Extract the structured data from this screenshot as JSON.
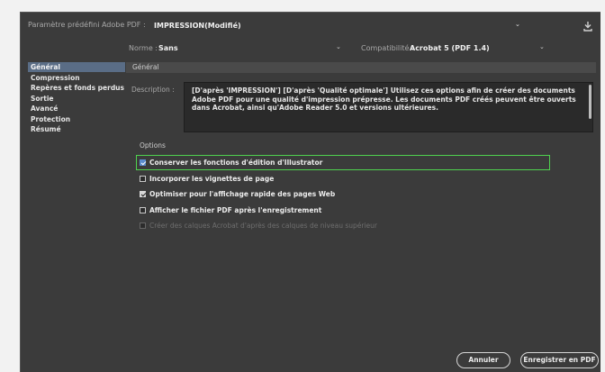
{
  "preset": {
    "label": "Paramètre prédéfini Adobe PDF :",
    "value": "IMPRESSION(Modifié)"
  },
  "standard": {
    "label": "Norme :",
    "value": "Sans"
  },
  "compatibility": {
    "label": "Compatibilité :",
    "value": "Acrobat 5 (PDF 1.4)"
  },
  "sidebar": {
    "items": [
      {
        "label": "Général",
        "active": true
      },
      {
        "label": "Compression",
        "active": false
      },
      {
        "label": "Repères et fonds perdus",
        "active": false
      },
      {
        "label": "Sortie",
        "active": false
      },
      {
        "label": "Avancé",
        "active": false
      },
      {
        "label": "Protection",
        "active": false
      },
      {
        "label": "Résumé",
        "active": false
      }
    ]
  },
  "general": {
    "header": "Général",
    "description_label": "Description :",
    "description_lines": [
      "[D'après 'IMPRESSION'] [D'après 'Qualité optimale'] Utilisez ces options afin de créer des documents",
      "Adobe PDF pour une qualité d'impression prépresse. Les documents PDF créés peuvent être ouverts",
      "dans Acrobat, ainsi qu'Adobe Reader 5.0 et versions ultérieures."
    ],
    "options_title": "Options",
    "options": [
      {
        "label": "Conserver les fonctions d'édition d'Illustrator",
        "checked": true,
        "enabled": true
      },
      {
        "label": "Incorporer les vignettes de page",
        "checked": false,
        "enabled": true
      },
      {
        "label": "Optimiser pour l'affichage rapide des pages Web",
        "checked": true,
        "enabled": true
      },
      {
        "label": "Afficher le fichier PDF après l'enregistrement",
        "checked": false,
        "enabled": true
      },
      {
        "label": "Créer des calques Acrobat d'après des calques de niveau supérieur",
        "checked": false,
        "enabled": false
      }
    ]
  },
  "buttons": {
    "cancel": "Annuler",
    "save": "Enregistrer en PDF"
  },
  "colors": {
    "panel": "#3b3b3b",
    "active_item": "#5a6d86",
    "highlight": "#4fd24f"
  }
}
